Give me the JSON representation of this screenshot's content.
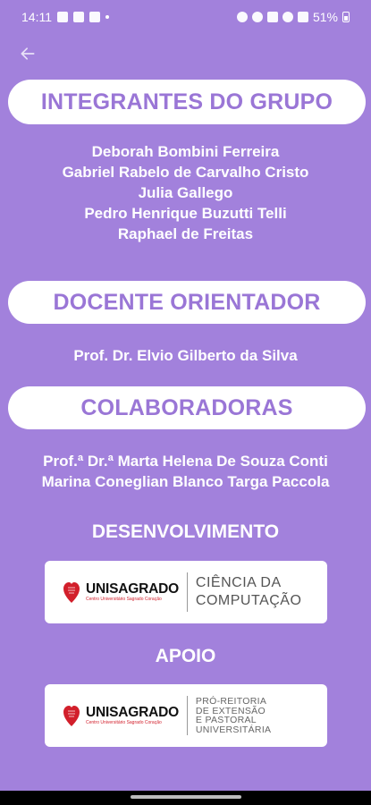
{
  "status_bar": {
    "time": "14:11",
    "battery": "51%"
  },
  "header": {
    "back_icon": "arrow-left-icon"
  },
  "sections": {
    "integrantes": {
      "title": "INTEGRANTES DO GRUPO",
      "members": [
        "Deborah Bombini Ferreira",
        "Gabriel Rabelo de Carvalho Cristo",
        "Julia Gallego",
        "Pedro Henrique Buzutti Telli",
        "Raphael de Freitas"
      ]
    },
    "docente": {
      "title": "DOCENTE ORIENTADOR",
      "name": "Prof. Dr. Elvio Gilberto da Silva"
    },
    "colaboradoras": {
      "title": "COLABORADORAS",
      "names": [
        "Prof.ª Dr.ª Marta Helena De Souza Conti",
        "Marina Coneglian Blanco Targa Paccola"
      ]
    },
    "desenvolvimento": {
      "title": "DESENVOLVIMENTO",
      "logo": {
        "brand": "UNISAGRADO",
        "brand_sub": "Centro Universitário Sagrado Coração",
        "dept_line1": "CIÊNCIA DA",
        "dept_line2": "COMPUTAÇÃO"
      }
    },
    "apoio": {
      "title": "APOIO",
      "logo": {
        "brand": "UNISAGRADO",
        "brand_sub": "Centro Universitário Sagrado Coração",
        "dept_lines": [
          "PRÓ-REITORIA",
          "DE EXTENSÃO",
          "E PASTORAL",
          "UNIVERSITÁRIA"
        ]
      }
    }
  },
  "colors": {
    "background": "#a281dc",
    "pill_text": "#9a76d6",
    "brand_red": "#d21f2b"
  }
}
